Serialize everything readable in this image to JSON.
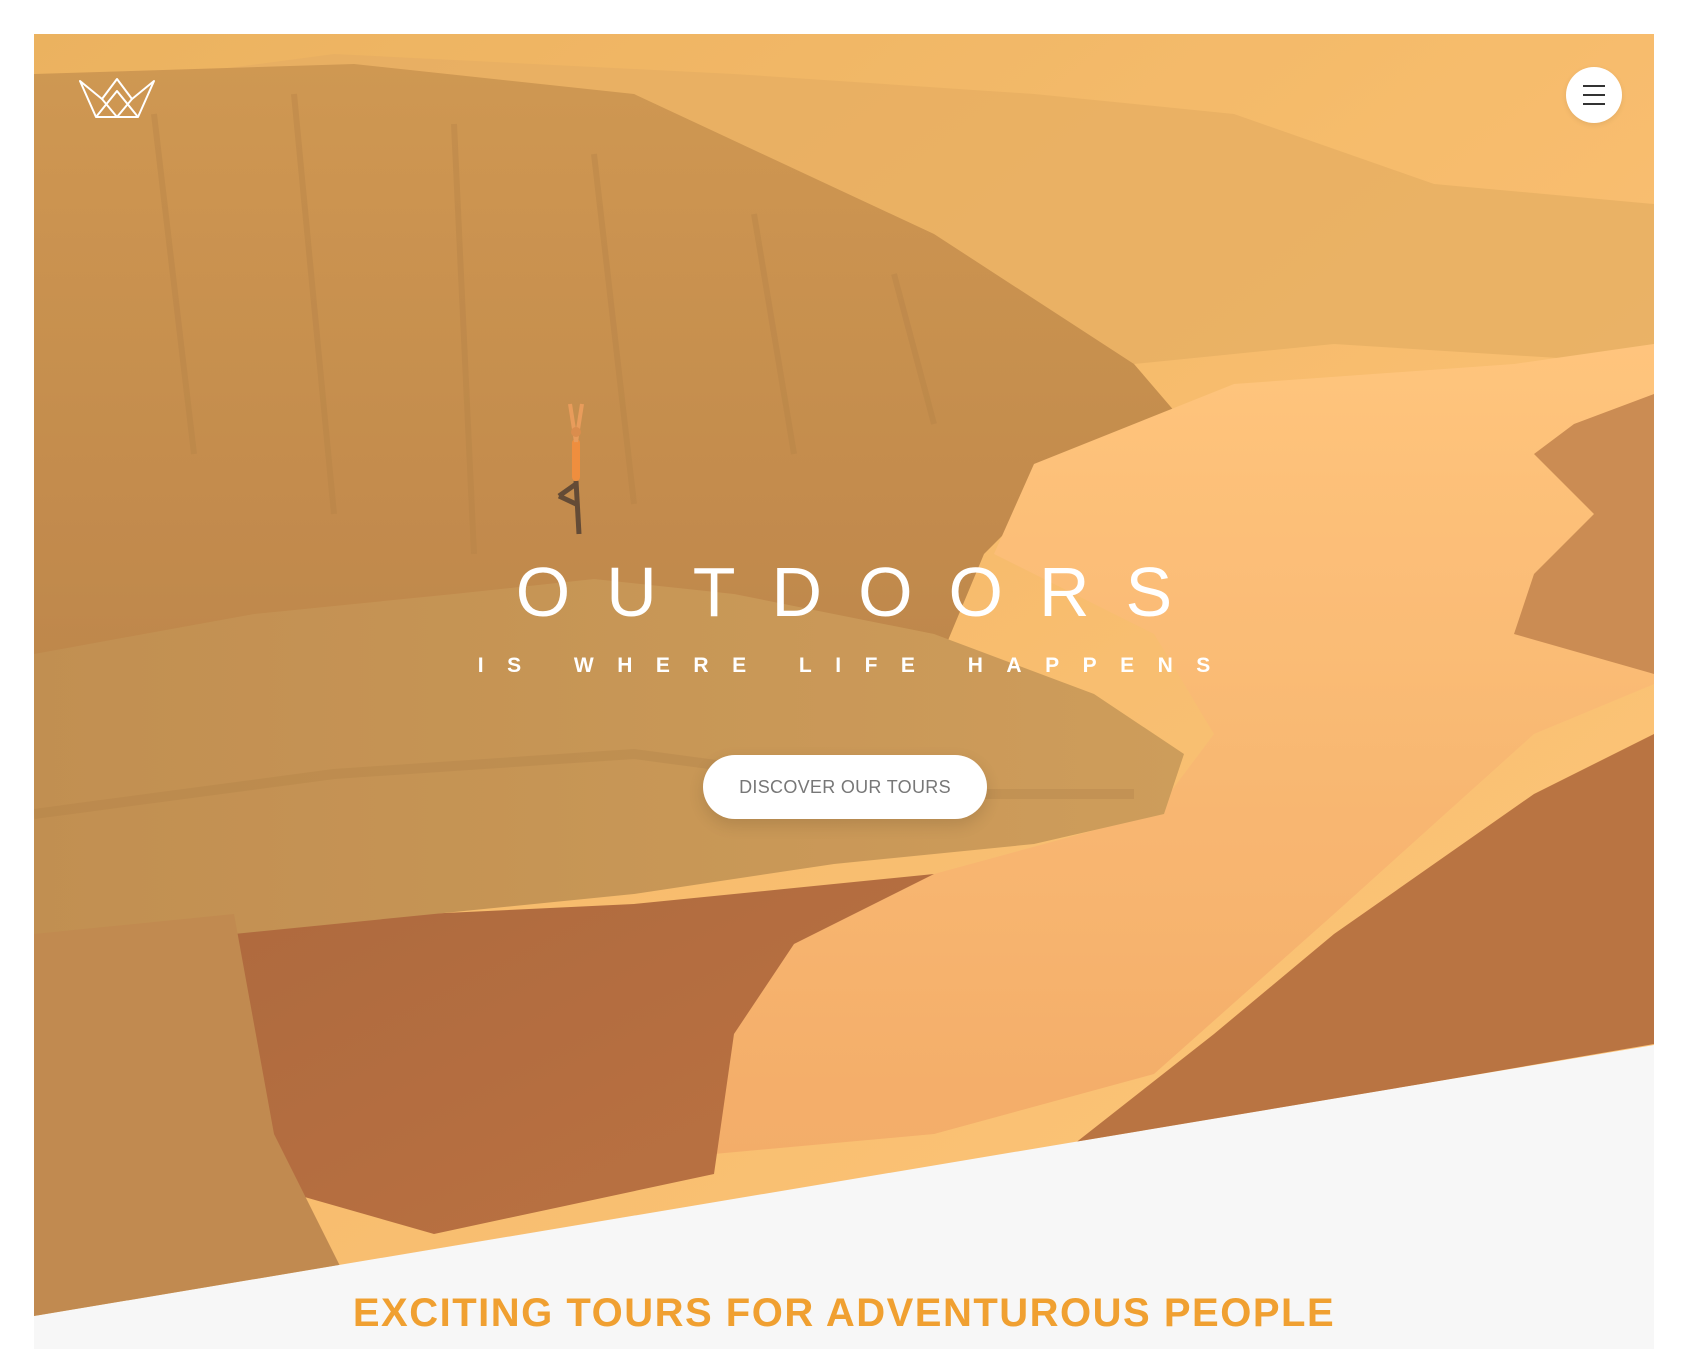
{
  "header": {
    "logo_icon": "crown-icon",
    "menu_icon": "hamburger-menu-icon"
  },
  "hero": {
    "title": "OUTDOORS",
    "subtitle": "IS WHERE LIFE HAPPENS",
    "cta_label": "DISCOVER OUR TOURS"
  },
  "section": {
    "heading": "EXCITING TOURS FOR ADVENTUROUS PEOPLE"
  },
  "colors": {
    "accent": "#f0a031",
    "hero_tint_light": "#ffc37a",
    "hero_tint_dark": "#a8613b",
    "section_bg": "#f7f7f7"
  }
}
